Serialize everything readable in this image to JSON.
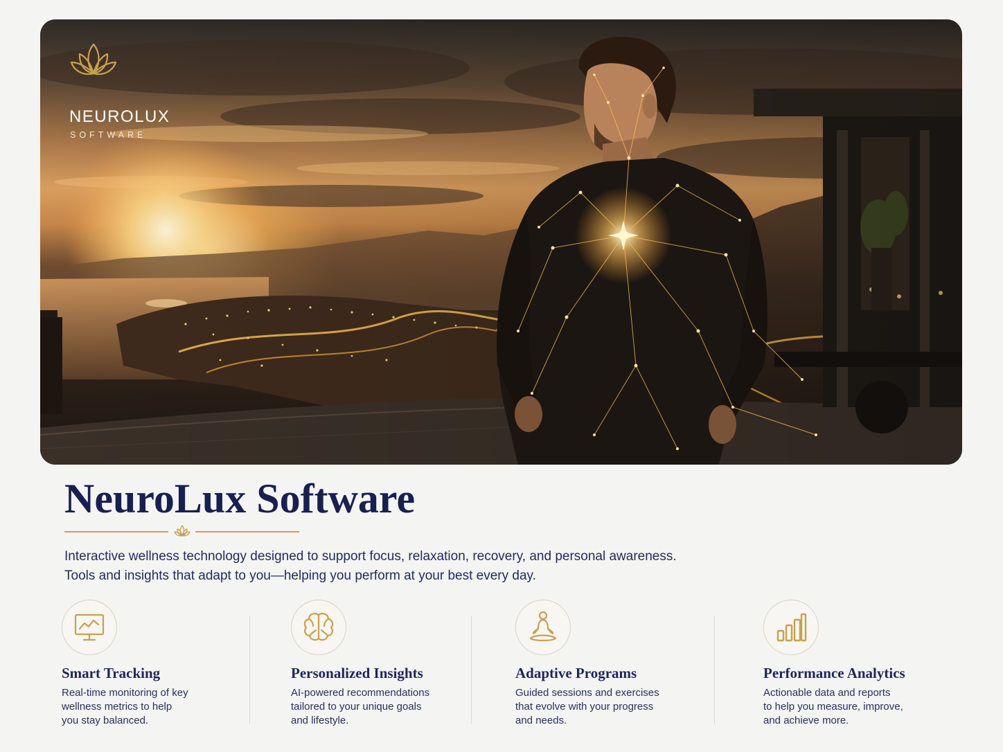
{
  "brand": {
    "name": "NEUROLUX",
    "sub": "SOFTWARE",
    "logo_icon": "lotus-icon"
  },
  "colors": {
    "gold": "#c9a04e",
    "navy": "#17204f",
    "background": "#f4f4f3"
  },
  "hero": {
    "image": "man-with-glowing-neural-network-at-sunset-city-terrace"
  },
  "page": {
    "title": "NeuroLux Software",
    "description_lines": [
      "Interactive wellness technology designed to support focus, relaxation, recovery, and personal awareness.",
      "Tools and insights that adapt to you—helping you perform at your best every day."
    ]
  },
  "features": [
    {
      "icon": "monitor-chart-icon",
      "title": "Smart Tracking",
      "desc": "Real-time monitoring of key\nwellness metrics to help\nyou stay balanced."
    },
    {
      "icon": "brain-icon",
      "title": "Personalized Insights",
      "desc": "AI-powered recommendations\ntailored to your unique goals\nand lifestyle."
    },
    {
      "icon": "meditation-icon",
      "title": "Adaptive Programs",
      "desc": "Guided sessions and exercises\nthat evolve with your progress\nand needs."
    },
    {
      "icon": "bar-chart-icon",
      "title": "Performance Analytics",
      "desc": "Actionable data and reports\nto help you measure, improve,\nand achieve more."
    }
  ]
}
